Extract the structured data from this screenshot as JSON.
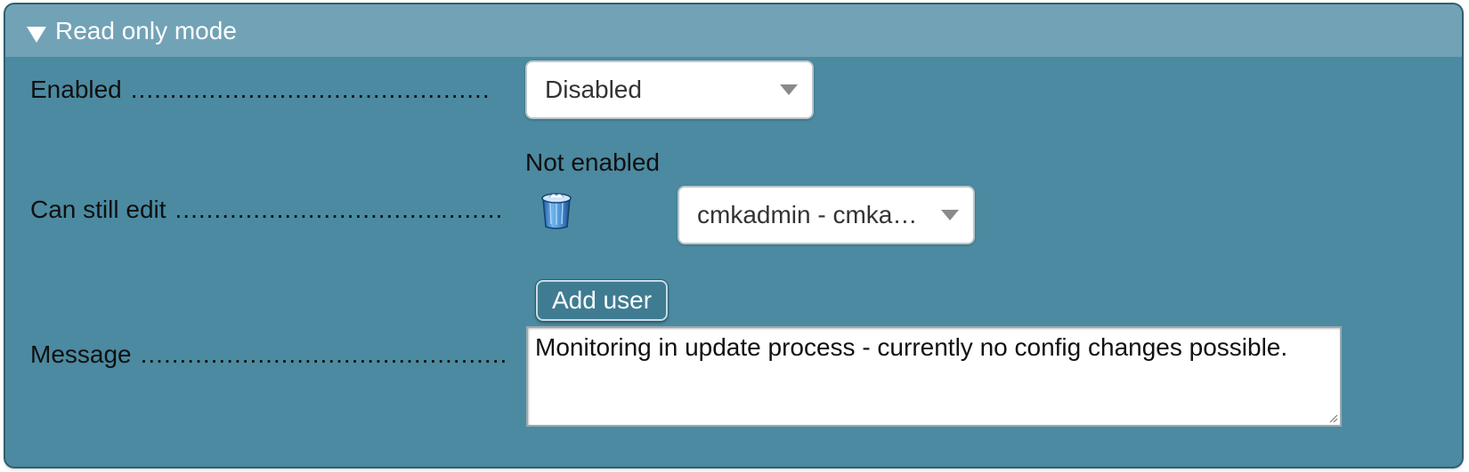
{
  "panel": {
    "title": "Read only mode",
    "toggle_icon": "triangle-down-icon"
  },
  "rows": {
    "enabled": {
      "label": "Enabled",
      "dots": "..............................................",
      "select_value": "Disabled"
    },
    "can_still_edit": {
      "label": "Can still edit",
      "dots": "..........................................",
      "status_text": "Not enabled",
      "delete_icon": "trash-icon",
      "user_select_value": "cmkadmin - cmka…",
      "add_user_label": "Add user"
    },
    "message": {
      "label": "Message",
      "dots": "...............................................",
      "value": "Monitoring in update process - currently no config changes possible."
    }
  },
  "colors": {
    "panel_body": "#4b8aa1",
    "panel_header": "#72a2b6",
    "button": "#3f7c92"
  }
}
